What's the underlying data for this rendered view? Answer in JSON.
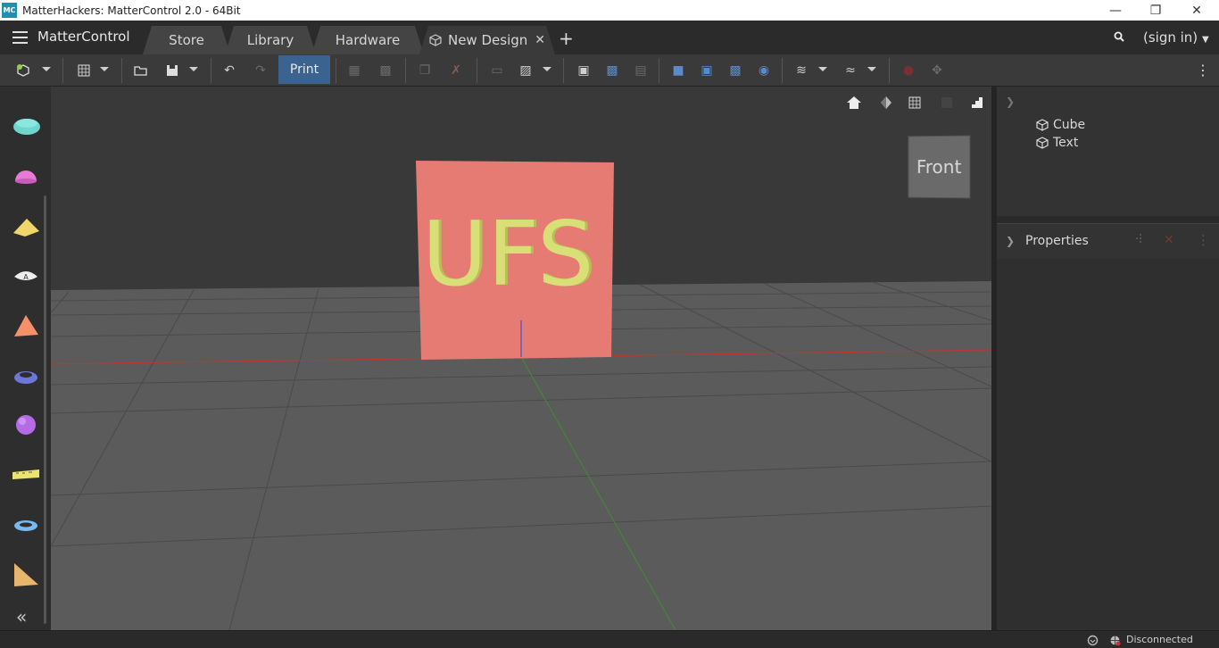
{
  "window": {
    "title": "MatterHackers: MatterControl 2.0 - 64Bit",
    "icon_text": "MC",
    "controls": [
      "minimize-icon",
      "restore-icon",
      "close-icon"
    ]
  },
  "header": {
    "app_name": "MatterControl",
    "tabs": [
      {
        "label": "Store"
      },
      {
        "label": "Library"
      },
      {
        "label": "Hardware"
      },
      {
        "label": "New Design",
        "active": true
      }
    ],
    "close_tab": "✕",
    "add_tab": "+",
    "signin": "(sign in)"
  },
  "toolbar": {
    "print_label": "Print",
    "colors": {
      "print_bg": "#3b6390",
      "accent_blue": "#5d89c9"
    }
  },
  "palette": {
    "shapes": [
      "cube",
      "half-sphere",
      "wedge",
      "text",
      "pyramid",
      "ring",
      "sphere",
      "image-converter",
      "torus",
      "half-wedge"
    ]
  },
  "viewport": {
    "cube_text": "UFS",
    "view_label": "Front",
    "colors": {
      "cube": "#e57b73",
      "text": "#d8df76",
      "floor": "#5a5a5a",
      "x_axis": "#c83232",
      "y_axis": "#3e8e2e"
    }
  },
  "scene_tree": {
    "items": [
      {
        "label": "Cube"
      },
      {
        "label": "Text"
      }
    ]
  },
  "properties": {
    "label": "Properties"
  },
  "status": {
    "connection": "Disconnected"
  }
}
